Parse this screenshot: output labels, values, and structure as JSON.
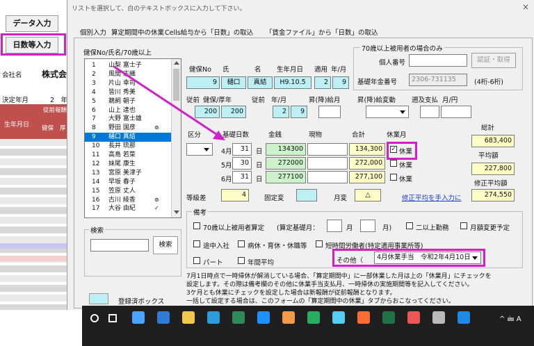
{
  "instruction": "リストを選択して、白のテキストボックスに入力して下さい。",
  "close_glyph": "×",
  "sheet": {
    "data_input_button": "データ入力",
    "days_input_button": "日数等入力",
    "company_label": "会社名",
    "company_value": "株式会",
    "year_label": "決定年月",
    "year_value": "2　年",
    "header_small": "従前報酬",
    "header_month": "生年月日",
    "header_kenpo": "健保",
    "header_kosei": "厚"
  },
  "tabs": [
    {
      "label": "個別入力"
    },
    {
      "label": "算定期間中の休業"
    },
    {
      "label": "Cells給与から「日数」の取込"
    },
    {
      "label": "「賃金ファイル」から「日数」の取込"
    }
  ],
  "list": {
    "header": "健保No/氏名/70歳以上",
    "items": [
      {
        "no": "1",
        "name": "山梨 富士子",
        "mark": ""
      },
      {
        "no": "2",
        "name": "風間 志織",
        "mark": ""
      },
      {
        "no": "3",
        "name": "片山 幸司",
        "mark": ""
      },
      {
        "no": "4",
        "name": "皆川 秀美",
        "mark": ""
      },
      {
        "no": "5",
        "name": "鵜飼 朝子",
        "mark": ""
      },
      {
        "no": "6",
        "name": "山上 達也",
        "mark": ""
      },
      {
        "no": "7",
        "name": "大野 富士雄",
        "mark": ""
      },
      {
        "no": "8",
        "name": "野田 国彦",
        "mark": "⊚"
      },
      {
        "no": "9",
        "name": "樋口 真結",
        "mark": ""
      },
      {
        "no": "10",
        "name": "長井 琉那",
        "mark": ""
      },
      {
        "no": "11",
        "name": "高島 若菜",
        "mark": ""
      },
      {
        "no": "12",
        "name": "妹尾 康生",
        "mark": ""
      },
      {
        "no": "13",
        "name": "宮原 美津子",
        "mark": ""
      },
      {
        "no": "14",
        "name": "早坂 春子",
        "mark": ""
      },
      {
        "no": "15",
        "name": "笠原 丈人",
        "mark": ""
      },
      {
        "no": "16",
        "name": "古川 綾香",
        "mark": "⊚"
      },
      {
        "no": "17",
        "name": "大谷 由紀",
        "mark": "✓"
      }
    ],
    "selected_index": 8
  },
  "search": {
    "group_label": "検索",
    "button": "検索",
    "value": ""
  },
  "legend": [
    {
      "label": "登録済ボックス",
      "color": "#bdf0f4"
    },
    {
      "label": "計算ボックス",
      "color": "#fffdc6"
    },
    {
      "label": "入力ボックス",
      "color": "#ffffff"
    }
  ],
  "over70": {
    "group_label": "70歳以上被用者の場合のみ",
    "personal_no_label": "個人番号",
    "personal_no_value": "",
    "auth_button": "認証・取得",
    "pension_label": "基礎年金番号",
    "pension_value": "2306-731135",
    "pension_hint": "(4桁-6桁)"
  },
  "person": {
    "headers": [
      "健保No",
      "氏",
      "名",
      "生年月日",
      "適用",
      "年/月"
    ],
    "kenpo_no": "9",
    "last_name": "樋口",
    "first_name": "真結",
    "birth": "H9.10.5",
    "apply_year": "2",
    "apply_month": "9"
  },
  "prior": {
    "headers": [
      "従前",
      "健保/厚年",
      "従前",
      "年/月",
      "昇(降)給月",
      "昇(降)給変動",
      "遡及支払",
      "月/円"
    ],
    "kenpo": "200",
    "kosei": "200",
    "year": "2",
    "month": "9",
    "raise_month": "",
    "raise_change": "",
    "retro_month": "",
    "retro_amount": ""
  },
  "calc": {
    "kubun_label": "区分",
    "days_label": "基礎日数",
    "money_label": "金銭",
    "goods_label": "現物",
    "total_label": "合計",
    "leave_label": "休業月",
    "grand_total_label": "総計",
    "grand_total": "683,400",
    "avg_label": "平均額",
    "avg": "227,800",
    "mod_avg_label": "修正平均額",
    "mod_avg": "274,550",
    "day_unit": "日",
    "leave_check_label": "休業",
    "rows": [
      {
        "month": "4月",
        "days": "31",
        "money": "134300",
        "goods": "",
        "total": "134,300",
        "leave": true
      },
      {
        "month": "5月",
        "days": "30",
        "money": "272000",
        "goods": "",
        "total": "272,000",
        "leave": false
      },
      {
        "month": "6月",
        "days": "31",
        "money": "277100",
        "goods": "",
        "total": "277,100",
        "leave": false
      }
    ],
    "grade_label": "等級差",
    "grade_value": "4",
    "fixed_label": "固定変",
    "fixed_value": "",
    "monthly_label": "月変",
    "monthly_value": "△",
    "manual_link": "修正平均を手入力に"
  },
  "remarks": {
    "group_label": "備考",
    "over70_label": "70歳以上被用者算定",
    "base_month_label": "(算定基礎月：",
    "month_unit": "月",
    "close_paren": "月)",
    "dual_label": "二以上勤務",
    "monthly_change_label": "月額変更予定",
    "mid_join_label": "途中入社",
    "sick_leave_label": "病休・育休・休職等",
    "short_label": "短時間労働者(特定適用事業所等)",
    "part_label": "パート",
    "annual_label": "年間平均",
    "other_label": "その他（",
    "other_value": "4月休業手当　令和2年4月10日"
  },
  "notes": [
    "7月1日時点で一時帰休が解消している場合、「算定期間中」に一部休業した月は上の「休業月」にチェックを",
    "設定します。その際は備考欄のその他に休業手当支払月、一時帰休の実施期間等を記入してください。",
    "3ケ月とも休業にチェックを設定した場合は新報酬が従前報酬となります。",
    "一括して設定する場合は、このフォームの「算定期間中の休業」タブからおこなってください。"
  ],
  "taskbar": {
    "tray_text": "^ 🖮 A",
    "icons": [
      "search-icon",
      "task-view-icon",
      "mail-icon",
      "edge-icon",
      "store-icon",
      "explorer-icon",
      "excel-tool-icon",
      "ie-icon",
      "folder-icon",
      "app-icon",
      "greenshot-icon",
      "app2-icon",
      "teamviewer-icon",
      "firefox-icon",
      "excel-icon",
      "media-icon",
      "note-icon",
      "help-icon"
    ]
  }
}
